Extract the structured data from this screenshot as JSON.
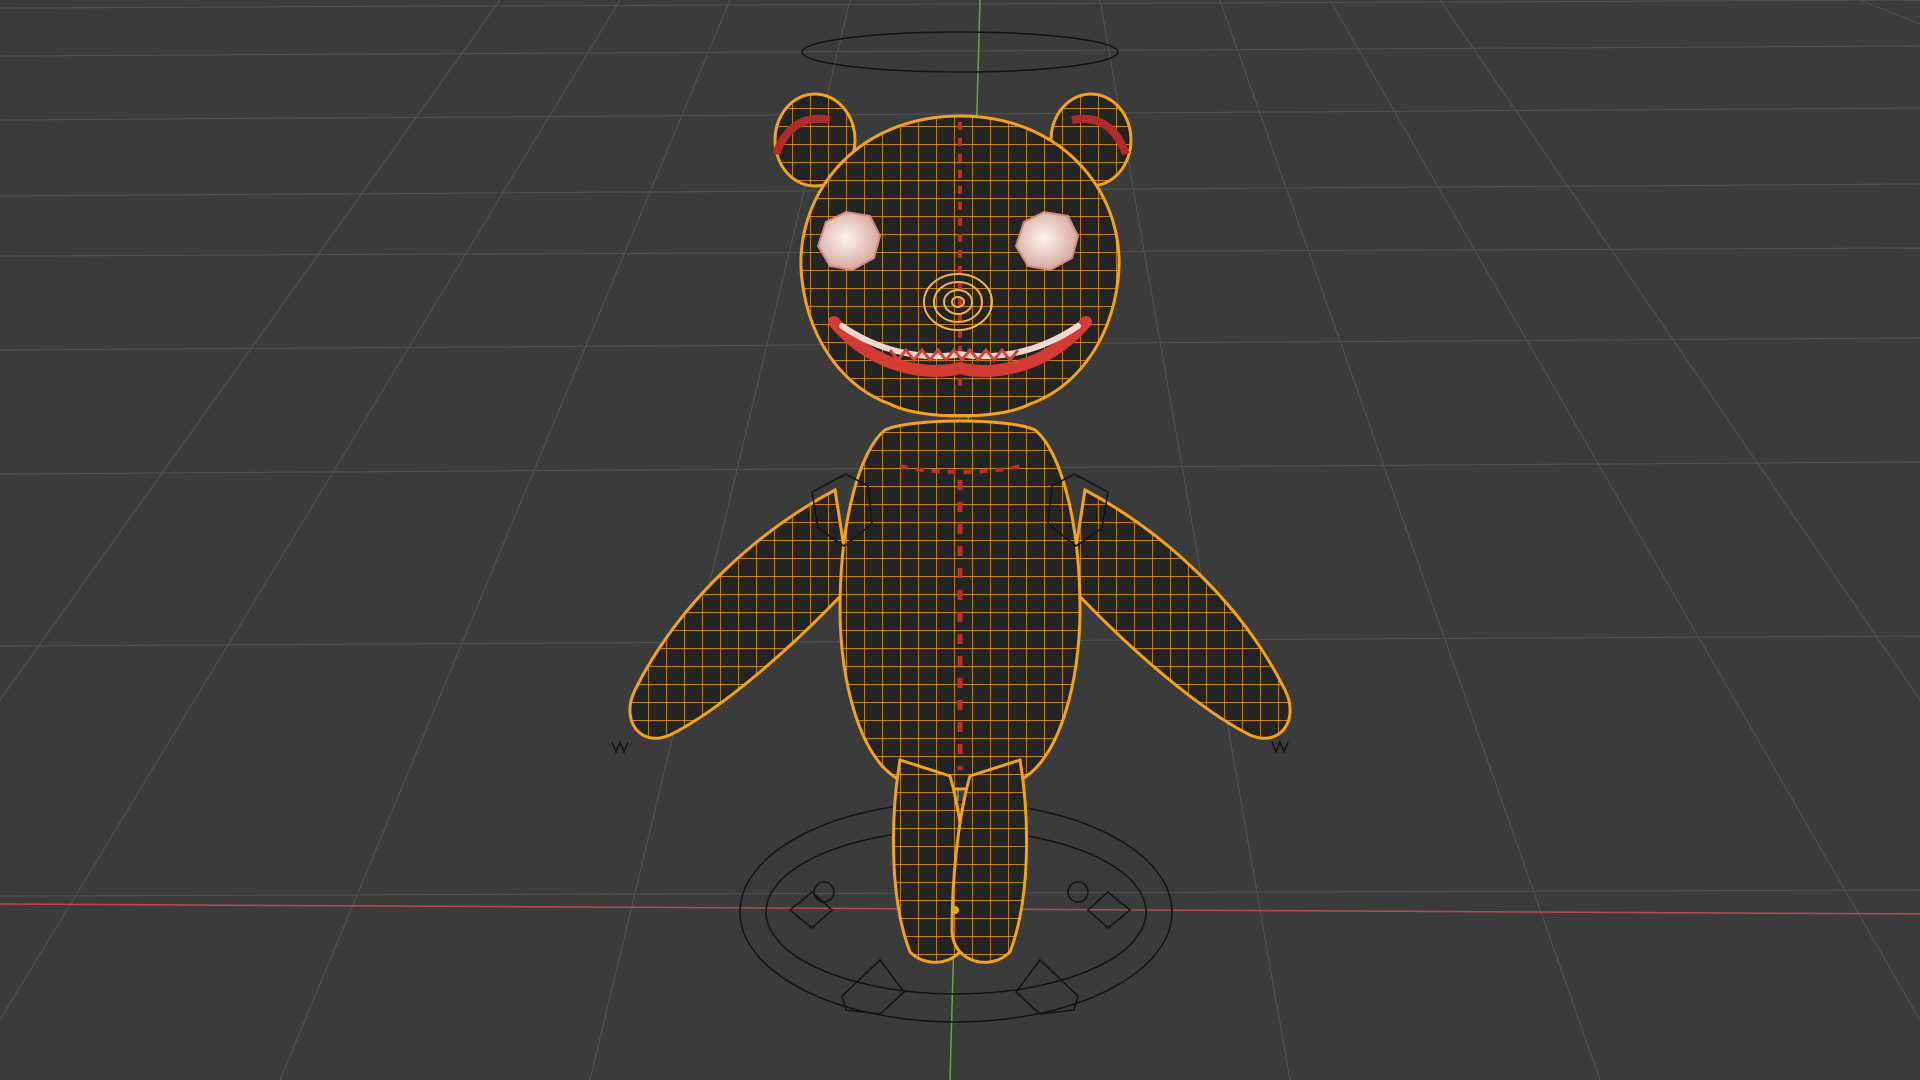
{
  "viewport": {
    "mode": "3d-viewport",
    "shading": "solid-with-wireframe-overlay",
    "background_color": "#3b3b3b",
    "grid_color": "#4f4f4f",
    "x_axis_color": "#b64a55",
    "y_axis_color": "#6fa23a",
    "selection_outline_color": "#f4a21e",
    "rig_wire_color": "#111111"
  },
  "object": {
    "name": "teddy-bear-model",
    "body_color": "#222222",
    "stitch_color": "#d3342a",
    "eye_color": "#f2d6d0",
    "mouth_color": "#e9c7c3",
    "selected": true
  }
}
